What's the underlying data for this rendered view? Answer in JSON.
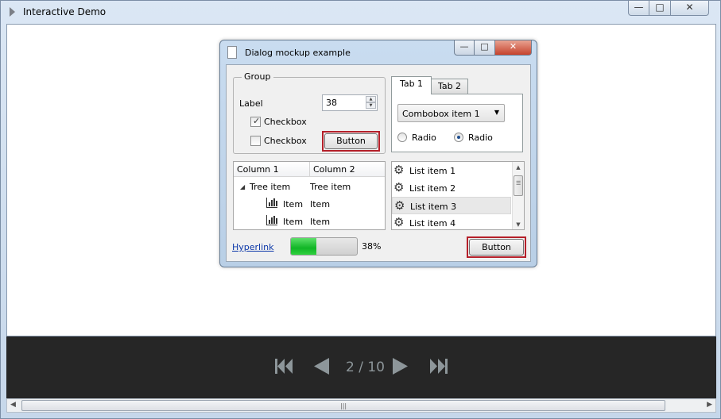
{
  "window": {
    "title": "Interactive Demo"
  },
  "dialog": {
    "title": "Dialog mockup example",
    "group": {
      "title": "Group",
      "label": "Label",
      "spin_value": "38",
      "checkbox1": {
        "label": "Checkbox",
        "checked": true
      },
      "checkbox2": {
        "label": "Checkbox",
        "checked": false
      },
      "button_label": "Button"
    },
    "tabs": [
      {
        "label": "Tab 1",
        "active": true
      },
      {
        "label": "Tab 2",
        "active": false
      }
    ],
    "combobox_value": "Combobox item 1",
    "radios": [
      {
        "label": "Radio",
        "selected": false
      },
      {
        "label": "Radio",
        "selected": true
      }
    ],
    "tree": {
      "columns": [
        "Column 1",
        "Column 2"
      ],
      "rows": [
        {
          "col1": "Tree item",
          "col2": "Tree item"
        },
        {
          "col1": "Item",
          "col2": "Item"
        },
        {
          "col1": "Item",
          "col2": "Item"
        }
      ]
    },
    "list": {
      "items": [
        "List item 1",
        "List item 2",
        "List item 3",
        "List item 4"
      ],
      "selected_index": 2
    },
    "hyperlink": "Hyperlink",
    "progress": {
      "value": 38,
      "text": "38%"
    },
    "bottom_button_label": "Button"
  },
  "player": {
    "page_indicator": "2 / 10"
  },
  "colors": {
    "highlight_outline": "#b5202a",
    "progress_green": "#11b526",
    "link": "#0b37a9",
    "player_bg": "#262626"
  }
}
